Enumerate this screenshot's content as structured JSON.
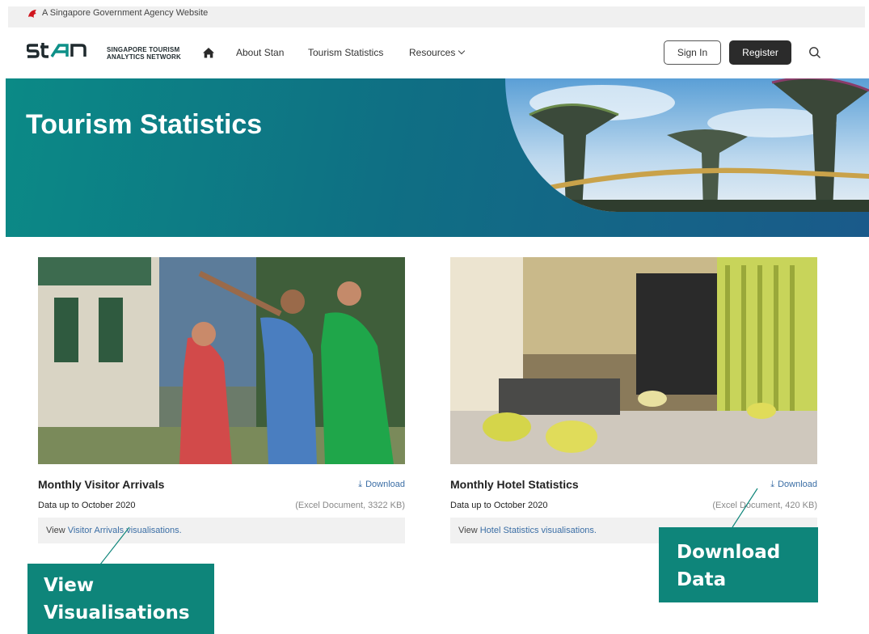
{
  "gov_banner": {
    "text": "A Singapore Government Agency Website",
    "icon": "lion-head-icon"
  },
  "header": {
    "logo": {
      "mark": "Stan",
      "subtitle_line1": "SINGAPORE TOURISM",
      "subtitle_line2": "ANALYTICS NETWORK"
    },
    "nav": {
      "about": "About Stan",
      "stats": "Tourism Statistics",
      "resources": "Resources"
    },
    "sign_in": "Sign In",
    "register": "Register"
  },
  "hero": {
    "title": "Tourism Statistics"
  },
  "cards": [
    {
      "title": "Monthly Visitor Arrivals",
      "download": "Download",
      "subtitle": "Data up to October 2020",
      "meta": "(Excel Document, 3322 KB)",
      "view_prefix": "View ",
      "view_link": "Visitor Arrivals visualisations."
    },
    {
      "title": "Monthly Hotel Statistics",
      "download": "Download",
      "subtitle": "Data up to October 2020",
      "meta": "(Excel Document, 420 KB)",
      "view_prefix": "View ",
      "view_link": "Hotel Statistics visualisations."
    }
  ],
  "callouts": {
    "left_line1": "View",
    "left_line2": "Visualisations",
    "right_line1": "Download",
    "right_line2": "Data"
  },
  "colors": {
    "accent": "#0e857a",
    "hero_start": "#0b8a86",
    "hero_end": "#1a5a8a",
    "link": "#3b6ea5"
  }
}
